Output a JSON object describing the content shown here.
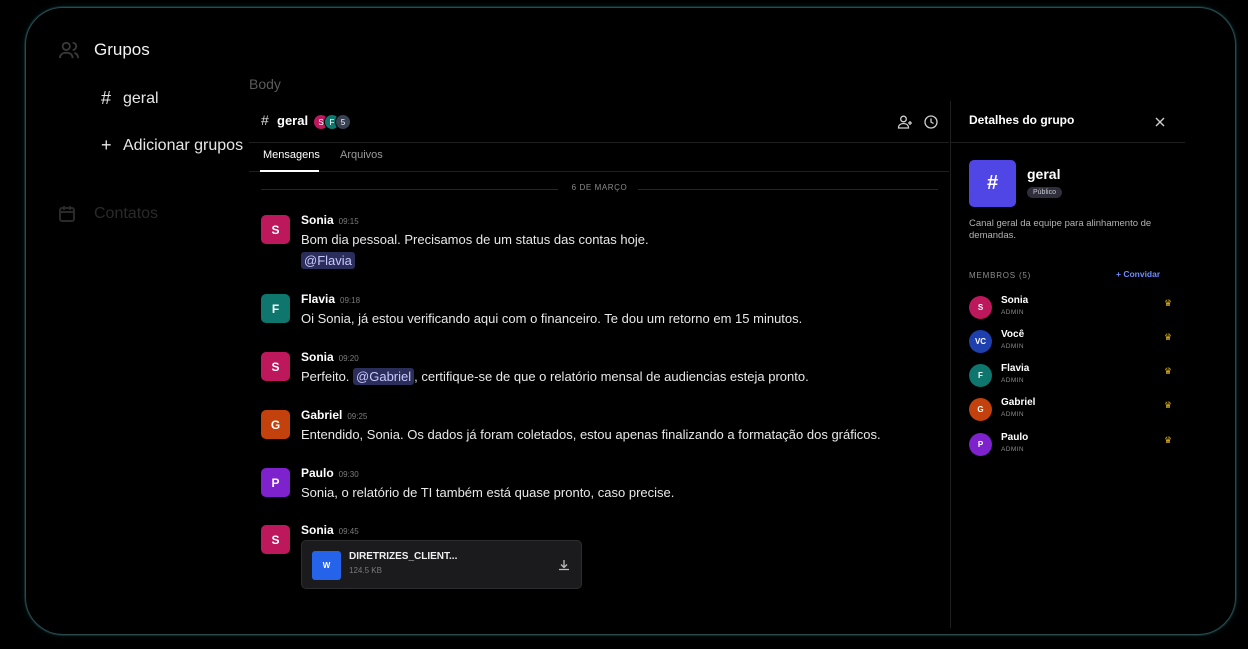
{
  "sidebar": {
    "title": "Grupos",
    "items": [
      {
        "glyph": "#",
        "label": "geral"
      },
      {
        "glyph": "+",
        "label": "Adicionar grupos"
      }
    ],
    "contacts_label": "Contatos"
  },
  "body_label": "Body",
  "chat": {
    "hash": "#",
    "title": "geral",
    "avatars": [
      {
        "initial": "S",
        "color": "#be185d"
      },
      {
        "initial": "F",
        "color": "#0f766e"
      },
      {
        "initial": "5",
        "color": "#374151"
      }
    ],
    "tabs": [
      "Mensagens",
      "Arquivos"
    ],
    "date_divider": "6 DE MARÇO",
    "messages": [
      {
        "initial": "S",
        "color": "#be185d",
        "name": "Sonia",
        "time": "09:15",
        "text": "Bom dia pessoal. Precisamos de um status das contas hoje.",
        "mention": "@Flavia"
      },
      {
        "initial": "F",
        "color": "#0f766e",
        "name": "Flavia",
        "time": "09:18",
        "text": "Oi Sonia, já estou verificando aqui com o financeiro. Te dou um retorno em 15 minutos."
      },
      {
        "initial": "S",
        "color": "#be185d",
        "name": "Sonia",
        "time": "09:20",
        "text_before": "Perfeito. ",
        "mention": "@Gabriel",
        "text_after": ", certifique-se de que o relatório mensal de audiencias esteja pronto."
      },
      {
        "initial": "G",
        "color": "#c2410c",
        "name": "Gabriel",
        "time": "09:25",
        "text": "Entendido, Sonia. Os dados já foram coletados, estou apenas finalizando a formatação dos gráficos."
      },
      {
        "initial": "P",
        "color": "#7e22ce",
        "name": "Paulo",
        "time": "09:30",
        "text": "Sonia, o relatório de TI também está quase pronto, caso precise."
      },
      {
        "initial": "S",
        "color": "#be185d",
        "name": "Sonia",
        "time": "09:45",
        "file": {
          "icon": "W",
          "name": "DIRETRIZES_CLIENT...",
          "size": "124.5 KB"
        }
      }
    ]
  },
  "details": {
    "title": "Detalhes do grupo",
    "group_glyph": "#",
    "group_name": "geral",
    "badge": "Público",
    "description": "Canal geral da equipe para alinhamento de demandas.",
    "members_label": "MEMBROS (5)",
    "invite_label": "+ Convidar",
    "members": [
      {
        "initials": "S",
        "color": "#be185d",
        "name": "Sonia",
        "role": "ADMIN"
      },
      {
        "initials": "VC",
        "color": "#1e40af",
        "name": "Você",
        "role": "ADMIN"
      },
      {
        "initials": "F",
        "color": "#0f766e",
        "name": "Flavia",
        "role": "ADMIN"
      },
      {
        "initials": "G",
        "color": "#c2410c",
        "name": "Gabriel",
        "role": "ADMIN"
      },
      {
        "initials": "P",
        "color": "#7e22ce",
        "name": "Paulo",
        "role": "ADMIN"
      }
    ]
  },
  "icons": [
    "users-icon",
    "calendar-icon",
    "add-member-icon",
    "history-icon",
    "close-icon",
    "download-icon",
    "crown-icon",
    "word-doc-icon"
  ]
}
